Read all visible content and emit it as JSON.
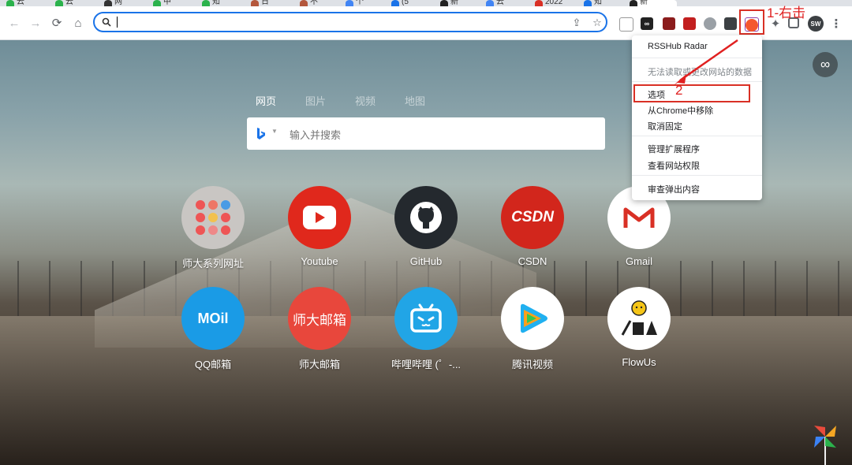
{
  "tabs": [
    {
      "title": "云"
    },
    {
      "title": "云"
    },
    {
      "title": "网"
    },
    {
      "title": "中"
    },
    {
      "title": "知"
    },
    {
      "title": "日"
    },
    {
      "title": "不"
    },
    {
      "title": "个"
    },
    {
      "title": "(5"
    },
    {
      "title": "新"
    },
    {
      "title": "云"
    },
    {
      "title": "2022"
    },
    {
      "title": "知"
    },
    {
      "title": "新"
    }
  ],
  "toolbar": {
    "back": "←",
    "forward": "→",
    "reload": "⟳",
    "home": "⌂",
    "url_value": "",
    "share": "⇪",
    "star": "☆",
    "profile": "SW",
    "menu": "⋮"
  },
  "annotations": {
    "step1": "1-右击",
    "step2": "2"
  },
  "search": {
    "tabs": [
      "网页",
      "图片",
      "视频",
      "地图"
    ],
    "placeholder": "输入并搜索"
  },
  "tiles": [
    {
      "label": "师大系列网址",
      "bg": "#c9c6c3"
    },
    {
      "label": "Youtube",
      "bg": "#e0281c"
    },
    {
      "label": "GitHub",
      "bg": "#24292e"
    },
    {
      "label": "CSDN",
      "bg": "#d2261c",
      "logo": "CSDN"
    },
    {
      "label": "Gmail",
      "bg": "#ffffff"
    },
    {
      "label": "QQ邮箱",
      "bg": "#1a9be6",
      "logo": "MOil"
    },
    {
      "label": "师大邮箱",
      "bg": "#e8473c",
      "logo": "师大邮箱"
    },
    {
      "label": "哔哩哔哩 (゜-...",
      "bg": "#21a5e6"
    },
    {
      "label": "腾讯视频",
      "bg": "#ffffff"
    },
    {
      "label": "FlowUs",
      "bg": "#ffffff"
    }
  ],
  "context_menu": {
    "title": "RSSHub Radar",
    "no_access": "无法读取或更改网站的数据",
    "options": "选项",
    "remove": "从Chrome中移除",
    "unpin": "取消固定",
    "manage": "管理扩展程序",
    "site_perms": "查看网站权限",
    "inspect": "审查弹出内容"
  },
  "infinity_icon": "∞",
  "colors": {
    "accent": "#1a73e8",
    "annotation": "#e02020"
  }
}
